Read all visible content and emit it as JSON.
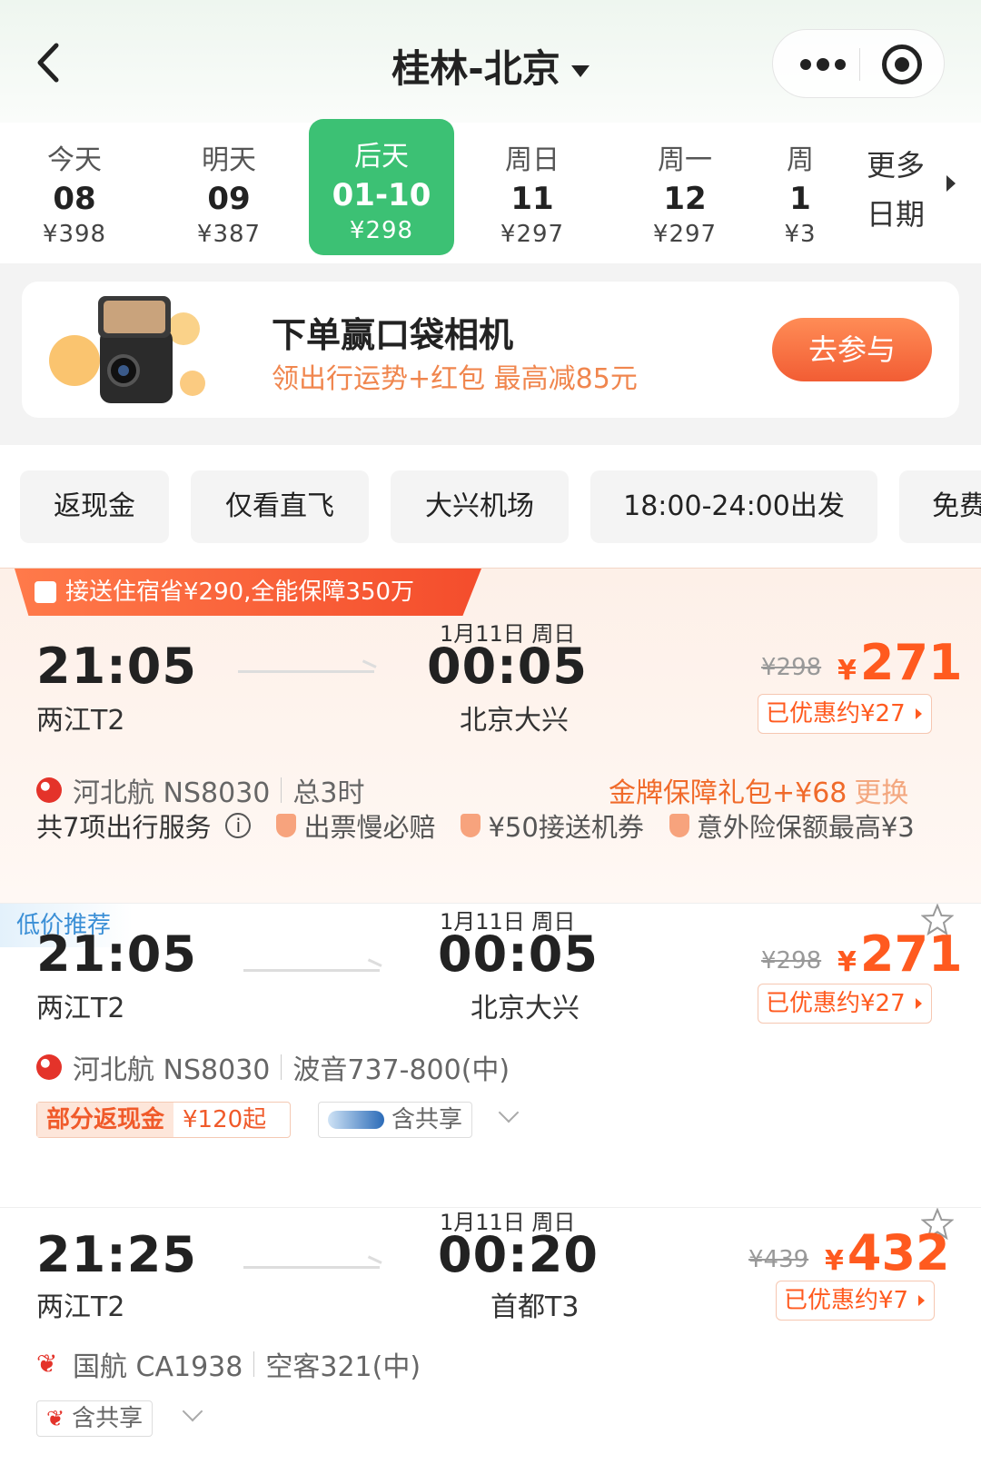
{
  "header": {
    "title": "桂林-北京"
  },
  "dates": [
    {
      "label": "今天",
      "day": "08",
      "price": "¥398"
    },
    {
      "label": "明天",
      "day": "09",
      "price": "¥387"
    },
    {
      "label": "后天",
      "day": "01-10",
      "price": "¥298",
      "active": true
    },
    {
      "label": "周日",
      "day": "11",
      "price": "¥297"
    },
    {
      "label": "周一",
      "day": "12",
      "price": "¥297"
    },
    {
      "label": "周",
      "day": "1",
      "price": "¥3"
    }
  ],
  "more_dates": {
    "line1": "更多",
    "line2": "日期"
  },
  "promo": {
    "title": "下单赢口袋相机",
    "subtitle": "领出行运势+红包 最高减85元",
    "button": "去参与"
  },
  "filters": [
    "返现金",
    "仅看直飞",
    "大兴机场",
    "18:00-24:00出发",
    "免费"
  ],
  "flights": [
    {
      "banner": "接送住宿省¥290,全能保障350万",
      "dep_time": "21:05",
      "dep_airport": "两江T2",
      "arr_date": "1月11日 周日",
      "arr_time": "00:05",
      "arr_airport": "北京大兴",
      "old_price": "¥298",
      "price": "271",
      "discount": "已优惠约¥27",
      "airline": "河北航 NS8030",
      "extra": "总3时",
      "gold": "金牌保障礼包+¥68",
      "gold_swap": "更换",
      "services_title": "共7项出行服务",
      "services": [
        "出票慢必赔",
        "¥50接送机券",
        "意外险保额最高¥3"
      ]
    },
    {
      "tag": "低价推荐",
      "dep_time": "21:05",
      "dep_airport": "两江T2",
      "arr_date": "1月11日 周日",
      "arr_time": "00:05",
      "arr_airport": "北京大兴",
      "old_price": "¥298",
      "price": "271",
      "discount": "已优惠约¥27",
      "airline": "河北航 NS8030",
      "extra": "波音737-800(中)",
      "cashback_a": "部分返现金",
      "cashback_b": "¥120起",
      "share": "含共享"
    },
    {
      "dep_time": "21:25",
      "dep_airport": "两江T2",
      "arr_date": "1月11日 周日",
      "arr_time": "00:20",
      "arr_airport": "首都T3",
      "old_price": "¥439",
      "price": "432",
      "discount": "已优惠约¥7",
      "airline": "国航 CA1938",
      "extra": "空客321(中)",
      "share": "含共享"
    }
  ],
  "yen_symbol": "¥"
}
